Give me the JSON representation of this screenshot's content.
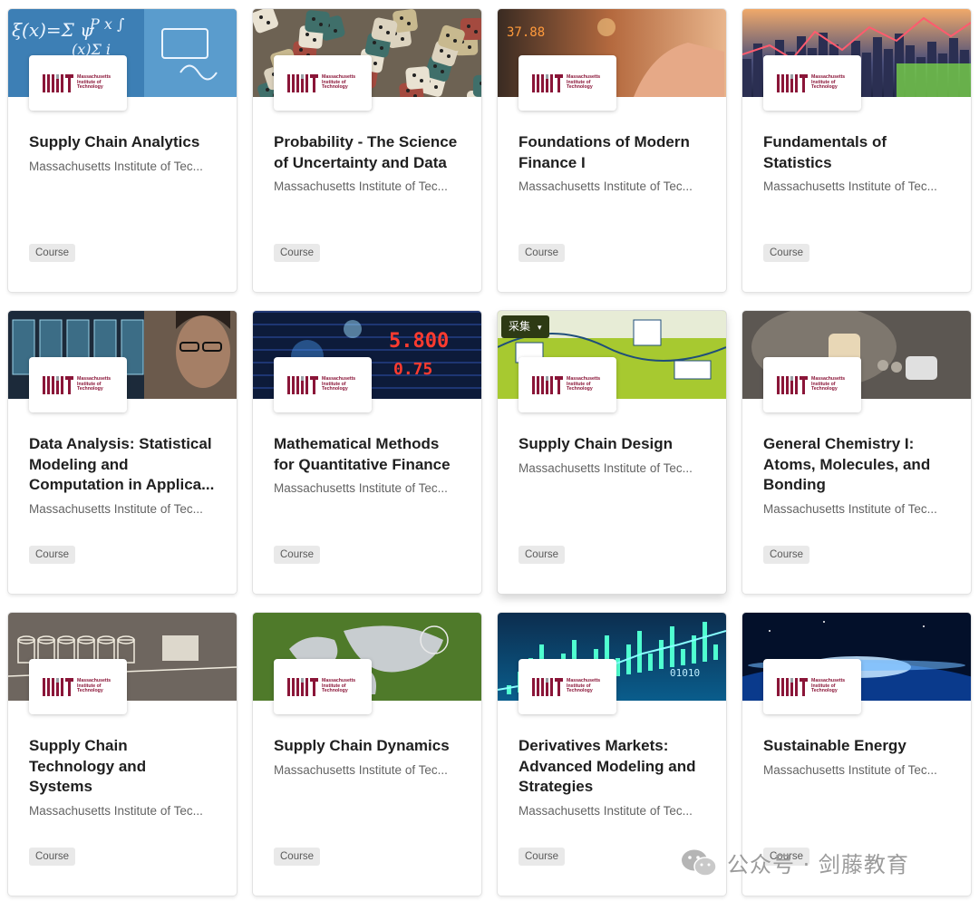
{
  "colors": {
    "mit_red": "#8a1538",
    "badge_bg": "#e9e9e9"
  },
  "logo_text": "Massachusetts Institute of Technology",
  "cards": [
    {
      "title_lines": [
        "Supply Chain Analytics"
      ],
      "partner": "Massachusetts Institute of Tec...",
      "badge": "Course",
      "image": "math-formula-blue"
    },
    {
      "title_lines": [
        "Probability - The Science",
        "of Uncertainty and Data"
      ],
      "partner": "Massachusetts Institute of Tec...",
      "badge": "Course",
      "image": "dice-pile"
    },
    {
      "title_lines": [
        "Foundations of Modern",
        "Finance I"
      ],
      "partner": "Massachusetts Institute of Tec...",
      "badge": "Course",
      "image": "finance-screen-hand"
    },
    {
      "title_lines": [
        "Fundamentals of",
        "Statistics"
      ],
      "partner": "Massachusetts Institute of Tec...",
      "badge": "Course",
      "image": "city-chart"
    },
    {
      "title_lines": [
        "Data Analysis: Statistical",
        "Modeling and",
        "Computation in Applica..."
      ],
      "partner": "Massachusetts Institute of Tec...",
      "badge": "Course",
      "image": "woman-monitors"
    },
    {
      "title_lines": [
        "Mathematical Methods",
        "for Quantitative Finance"
      ],
      "partner": "Massachusetts Institute of Tec...",
      "badge": "Course",
      "image": "stock-ticker"
    },
    {
      "title_lines": [
        "Supply Chain Design"
      ],
      "partner": "Massachusetts Institute of Tec...",
      "badge": "Course",
      "image": "supply-illustration",
      "overlay": {
        "label": "采集",
        "arrow": "▾"
      }
    },
    {
      "title_lines": [
        "General Chemistry I:",
        "Atoms, Molecules, and",
        "Bonding"
      ],
      "partner": "Massachusetts Institute of Tec...",
      "badge": "Course",
      "image": "chemistry-rock"
    },
    {
      "title_lines": [
        "Supply Chain",
        "Technology and",
        "Systems"
      ],
      "partner": "Massachusetts Institute of Tec...",
      "badge": "Course",
      "image": "chalk-warehouse"
    },
    {
      "title_lines": [
        "Supply Chain Dynamics"
      ],
      "partner": "Massachusetts Institute of Tec...",
      "badge": "Course",
      "image": "world-map-green"
    },
    {
      "title_lines": [
        "Derivatives Markets:",
        "Advanced Modeling and",
        "Strategies"
      ],
      "partner": "Massachusetts Institute of Tec...",
      "badge": "Course",
      "image": "candlestick-blue"
    },
    {
      "title_lines": [
        "Sustainable Energy"
      ],
      "partner": "Massachusetts Institute of Tec...",
      "badge": "Course",
      "image": "earth-sunrise"
    }
  ],
  "watermark": {
    "text": "公众号 · 剑藤教育",
    "icon": "wechat-icon"
  }
}
